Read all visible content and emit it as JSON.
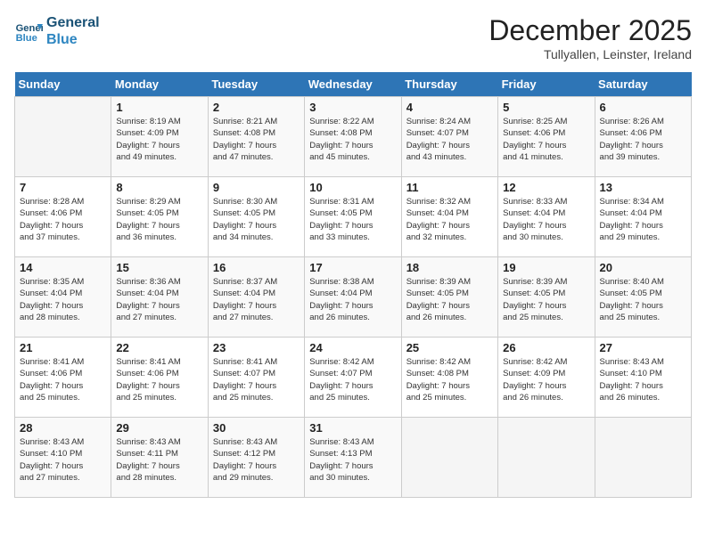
{
  "header": {
    "logo_line1": "General",
    "logo_line2": "Blue",
    "month": "December 2025",
    "location": "Tullyallen, Leinster, Ireland"
  },
  "days_of_week": [
    "Sunday",
    "Monday",
    "Tuesday",
    "Wednesday",
    "Thursday",
    "Friday",
    "Saturday"
  ],
  "weeks": [
    [
      {
        "day": "",
        "info": ""
      },
      {
        "day": "1",
        "info": "Sunrise: 8:19 AM\nSunset: 4:09 PM\nDaylight: 7 hours\nand 49 minutes."
      },
      {
        "day": "2",
        "info": "Sunrise: 8:21 AM\nSunset: 4:08 PM\nDaylight: 7 hours\nand 47 minutes."
      },
      {
        "day": "3",
        "info": "Sunrise: 8:22 AM\nSunset: 4:08 PM\nDaylight: 7 hours\nand 45 minutes."
      },
      {
        "day": "4",
        "info": "Sunrise: 8:24 AM\nSunset: 4:07 PM\nDaylight: 7 hours\nand 43 minutes."
      },
      {
        "day": "5",
        "info": "Sunrise: 8:25 AM\nSunset: 4:06 PM\nDaylight: 7 hours\nand 41 minutes."
      },
      {
        "day": "6",
        "info": "Sunrise: 8:26 AM\nSunset: 4:06 PM\nDaylight: 7 hours\nand 39 minutes."
      }
    ],
    [
      {
        "day": "7",
        "info": "Sunrise: 8:28 AM\nSunset: 4:06 PM\nDaylight: 7 hours\nand 37 minutes."
      },
      {
        "day": "8",
        "info": "Sunrise: 8:29 AM\nSunset: 4:05 PM\nDaylight: 7 hours\nand 36 minutes."
      },
      {
        "day": "9",
        "info": "Sunrise: 8:30 AM\nSunset: 4:05 PM\nDaylight: 7 hours\nand 34 minutes."
      },
      {
        "day": "10",
        "info": "Sunrise: 8:31 AM\nSunset: 4:05 PM\nDaylight: 7 hours\nand 33 minutes."
      },
      {
        "day": "11",
        "info": "Sunrise: 8:32 AM\nSunset: 4:04 PM\nDaylight: 7 hours\nand 32 minutes."
      },
      {
        "day": "12",
        "info": "Sunrise: 8:33 AM\nSunset: 4:04 PM\nDaylight: 7 hours\nand 30 minutes."
      },
      {
        "day": "13",
        "info": "Sunrise: 8:34 AM\nSunset: 4:04 PM\nDaylight: 7 hours\nand 29 minutes."
      }
    ],
    [
      {
        "day": "14",
        "info": "Sunrise: 8:35 AM\nSunset: 4:04 PM\nDaylight: 7 hours\nand 28 minutes."
      },
      {
        "day": "15",
        "info": "Sunrise: 8:36 AM\nSunset: 4:04 PM\nDaylight: 7 hours\nand 27 minutes."
      },
      {
        "day": "16",
        "info": "Sunrise: 8:37 AM\nSunset: 4:04 PM\nDaylight: 7 hours\nand 27 minutes."
      },
      {
        "day": "17",
        "info": "Sunrise: 8:38 AM\nSunset: 4:04 PM\nDaylight: 7 hours\nand 26 minutes."
      },
      {
        "day": "18",
        "info": "Sunrise: 8:39 AM\nSunset: 4:05 PM\nDaylight: 7 hours\nand 26 minutes."
      },
      {
        "day": "19",
        "info": "Sunrise: 8:39 AM\nSunset: 4:05 PM\nDaylight: 7 hours\nand 25 minutes."
      },
      {
        "day": "20",
        "info": "Sunrise: 8:40 AM\nSunset: 4:05 PM\nDaylight: 7 hours\nand 25 minutes."
      }
    ],
    [
      {
        "day": "21",
        "info": "Sunrise: 8:41 AM\nSunset: 4:06 PM\nDaylight: 7 hours\nand 25 minutes."
      },
      {
        "day": "22",
        "info": "Sunrise: 8:41 AM\nSunset: 4:06 PM\nDaylight: 7 hours\nand 25 minutes."
      },
      {
        "day": "23",
        "info": "Sunrise: 8:41 AM\nSunset: 4:07 PM\nDaylight: 7 hours\nand 25 minutes."
      },
      {
        "day": "24",
        "info": "Sunrise: 8:42 AM\nSunset: 4:07 PM\nDaylight: 7 hours\nand 25 minutes."
      },
      {
        "day": "25",
        "info": "Sunrise: 8:42 AM\nSunset: 4:08 PM\nDaylight: 7 hours\nand 25 minutes."
      },
      {
        "day": "26",
        "info": "Sunrise: 8:42 AM\nSunset: 4:09 PM\nDaylight: 7 hours\nand 26 minutes."
      },
      {
        "day": "27",
        "info": "Sunrise: 8:43 AM\nSunset: 4:10 PM\nDaylight: 7 hours\nand 26 minutes."
      }
    ],
    [
      {
        "day": "28",
        "info": "Sunrise: 8:43 AM\nSunset: 4:10 PM\nDaylight: 7 hours\nand 27 minutes."
      },
      {
        "day": "29",
        "info": "Sunrise: 8:43 AM\nSunset: 4:11 PM\nDaylight: 7 hours\nand 28 minutes."
      },
      {
        "day": "30",
        "info": "Sunrise: 8:43 AM\nSunset: 4:12 PM\nDaylight: 7 hours\nand 29 minutes."
      },
      {
        "day": "31",
        "info": "Sunrise: 8:43 AM\nSunset: 4:13 PM\nDaylight: 7 hours\nand 30 minutes."
      },
      {
        "day": "",
        "info": ""
      },
      {
        "day": "",
        "info": ""
      },
      {
        "day": "",
        "info": ""
      }
    ]
  ]
}
